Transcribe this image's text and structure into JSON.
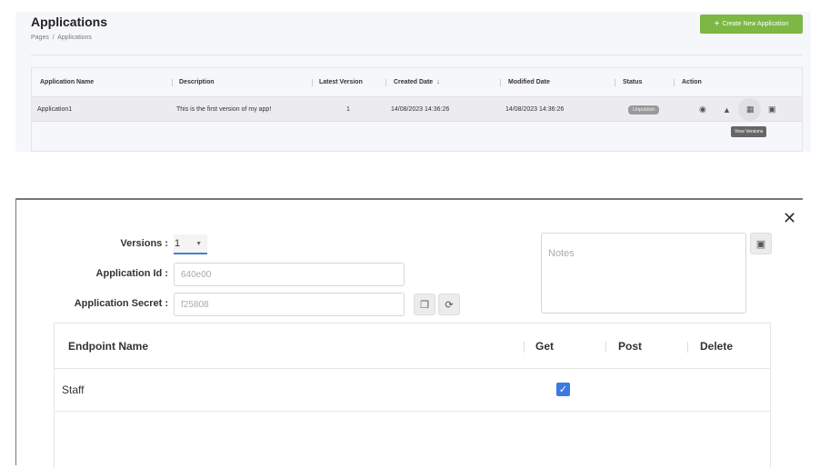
{
  "page": {
    "title": "Applications",
    "breadcrumb": "Pages  /  Applications",
    "create_button": "Create New Application"
  },
  "table": {
    "headers": [
      "Application Name",
      "Description",
      "Latest Version",
      "Created Date",
      "Modified Date",
      "Status",
      "Action"
    ],
    "rows": [
      {
        "name": "Application1",
        "description": "This is the first version of my app!",
        "version": "1",
        "created": "14/08/2023 14:36:26",
        "modified": "14/08/2023 14:36:26",
        "status": "Unpublish"
      }
    ],
    "tooltip": "View Versions"
  },
  "modal": {
    "versions_label": "Versions :",
    "versions_value": "1",
    "app_id_label": "Application Id :",
    "app_id_value": "640e00",
    "secret_label": "Application Secret :",
    "secret_value": "f25808",
    "notes_placeholder": "Notes",
    "endpoint_headers": [
      "Endpoint Name",
      "Get",
      "Post",
      "Delete"
    ],
    "endpoints": [
      {
        "name": "Staff",
        "get": true,
        "post": false,
        "delete": false
      }
    ]
  },
  "colors": {
    "accent": "#7cb843",
    "checkbox": "#3b7be0"
  }
}
